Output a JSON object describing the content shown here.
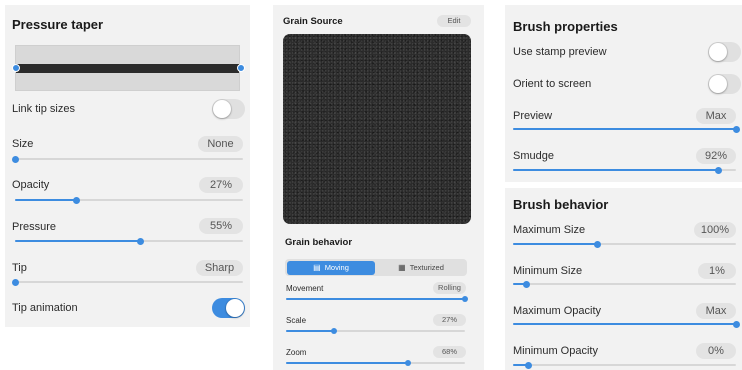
{
  "colors": {
    "accent": "#3d8ce0",
    "panel": "#f2f2f2",
    "pill": "#e3e3e3"
  },
  "pressure_panel": {
    "title": "Pressure taper",
    "rows": [
      {
        "label": "Link tip sizes",
        "control": "toggle",
        "on": false
      },
      {
        "label": "Size",
        "value": "None",
        "level": 0
      },
      {
        "label": "Opacity",
        "value": "27%",
        "level": 0.27
      },
      {
        "label": "Pressure",
        "value": "55%",
        "level": 0.55
      },
      {
        "label": "Tip",
        "value": "Sharp",
        "level": 0
      },
      {
        "label": "Tip animation",
        "control": "toggle",
        "on": true
      }
    ]
  },
  "grain_panel": {
    "source_title": "Grain Source",
    "edit_label": "Edit",
    "behavior_title": "Grain behavior",
    "tabs": [
      {
        "label": "Moving",
        "icon": "moving-icon",
        "active": true
      },
      {
        "label": "Texturized",
        "icon": "texturized-icon",
        "active": false
      }
    ],
    "rows": [
      {
        "label": "Movement",
        "value": "Rolling",
        "level": 1.0
      },
      {
        "label": "Scale",
        "value": "27%",
        "level": 0.27
      },
      {
        "label": "Zoom",
        "value": "68%",
        "level": 0.68
      }
    ]
  },
  "brush_panel": {
    "properties_title": "Brush properties",
    "toggles": [
      {
        "label": "Use stamp preview",
        "on": false
      },
      {
        "label": "Orient to screen",
        "on": false
      }
    ],
    "property_rows": [
      {
        "label": "Preview",
        "value": "Max",
        "level": 1.0
      },
      {
        "label": "Smudge",
        "value": "92%",
        "level": 0.92
      }
    ],
    "behavior_title": "Brush behavior",
    "behavior_rows": [
      {
        "label": "Maximum Size",
        "value": "100%",
        "level": 0.38
      },
      {
        "label": "Minimum Size",
        "value": "1%",
        "level": 0.06
      },
      {
        "label": "Maximum Opacity",
        "value": "Max",
        "level": 1.0
      },
      {
        "label": "Minimum Opacity",
        "value": "0%",
        "level": 0.07
      }
    ]
  }
}
